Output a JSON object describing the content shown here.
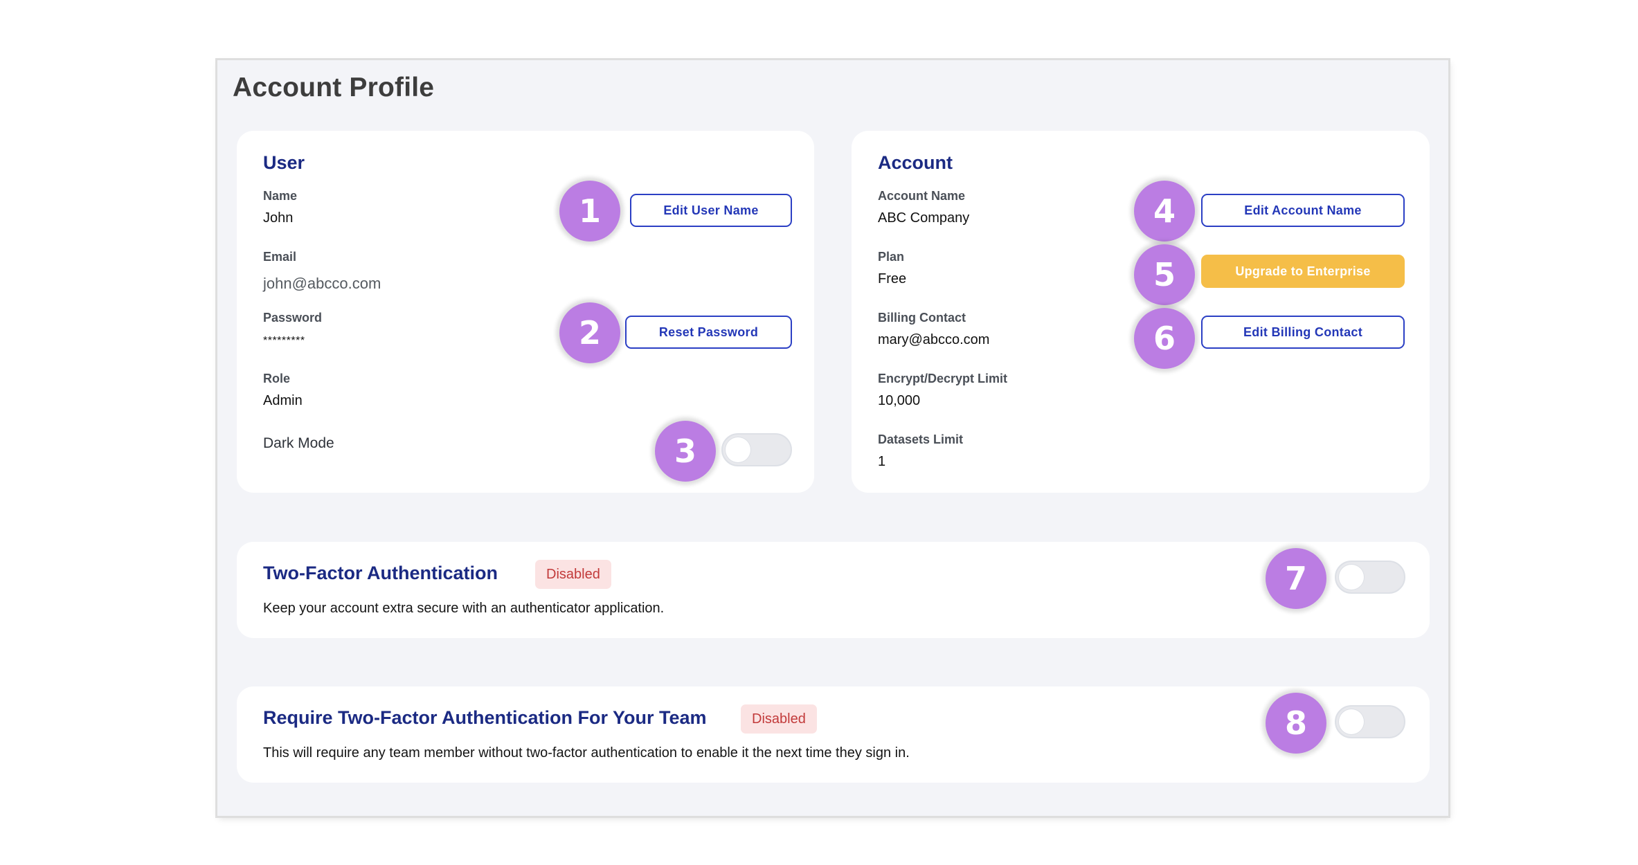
{
  "page": {
    "title": "Account Profile"
  },
  "user_card": {
    "heading": "User",
    "name_label": "Name",
    "name_value": "John",
    "email_label": "Email",
    "email_value": "john@abcco.com",
    "password_label": "Password",
    "password_value": "*********",
    "role_label": "Role",
    "role_value": "Admin",
    "dark_mode_label": "Dark Mode",
    "dark_mode_enabled": false,
    "edit_user_name_button": "Edit User Name",
    "reset_password_button": "Reset Password"
  },
  "account_card": {
    "heading": "Account",
    "account_name_label": "Account Name",
    "account_name_value": "ABC Company",
    "plan_label": "Plan",
    "plan_value": "Free",
    "billing_contact_label": "Billing Contact",
    "billing_contact_value": "mary@abcco.com",
    "encrypt_limit_label": "Encrypt/Decrypt Limit",
    "encrypt_limit_value": "10,000",
    "datasets_limit_label": "Datasets Limit",
    "datasets_limit_value": "1",
    "edit_account_name_button": "Edit Account Name",
    "upgrade_button": "Upgrade to Enterprise",
    "edit_billing_contact_button": "Edit Billing Contact"
  },
  "two_factor": {
    "title": "Two-Factor Authentication",
    "status": "Disabled",
    "description": "Keep your account extra secure with an authenticator application.",
    "enabled": false
  },
  "team_two_factor": {
    "title": "Require Two-Factor Authentication For Your Team",
    "status": "Disabled",
    "description": "This will require any team member without two-factor authentication to enable it the next time they sign in.",
    "enabled": false
  },
  "step_badges": [
    "1",
    "2",
    "3",
    "4",
    "5",
    "6",
    "7",
    "8"
  ],
  "colors": {
    "heading": "#1b2a83",
    "button_outline": "#2b3fc4",
    "upgrade": "#f5be48",
    "step_badge": "#bb7de3",
    "disabled_badge_bg": "#fbe3e3",
    "disabled_badge_text": "#c23a3a",
    "page_bg": "#f3f4f8"
  }
}
